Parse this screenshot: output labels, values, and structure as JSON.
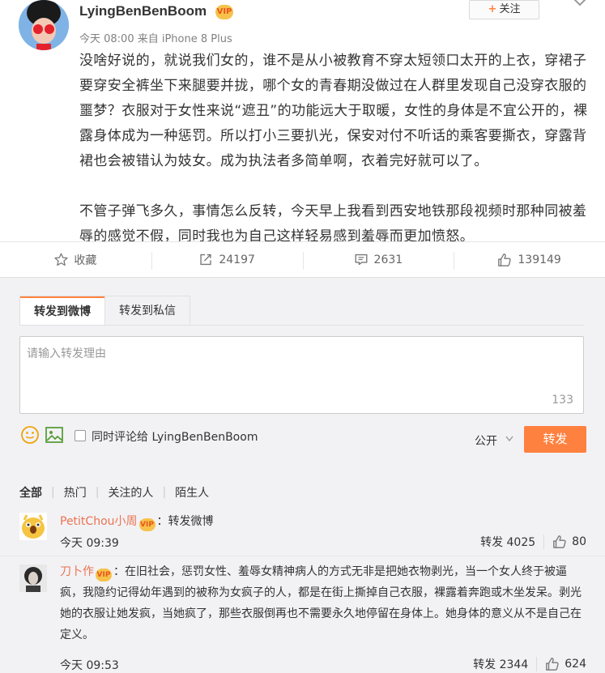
{
  "post": {
    "username": "LyingBenBenBoom",
    "vip_badge": "VIP",
    "meta": "今天 08:00 来自 iPhone 8 Plus",
    "follow_label": "关注",
    "follow_plus": "+",
    "paragraphs": [
      "没啥好说的，就说我们女的，谁不是从小被教育不穿太短领口太开的上衣，穿裙子要穿安全裤坐下来腿要并拢，哪个女的青春期没做过在人群里发现自己没穿衣服的噩梦？衣服对于女性来说“遮丑”的功能远大于取暖，女性的身体是不宜公开的，裸露身体成为一种惩罚。所以打小三要扒光，保安对付不听话的乘客要撕衣，穿露背裙也会被错认为妓女。成为执法者多简单啊，衣着完好就可以了。",
      "不管子弹飞多久，事情怎么反转，今天早上我看到西安地铁那段视频时那种同被羞辱的感觉不假，同时我也为自己这样轻易感到羞辱而更加愤怒。"
    ]
  },
  "actions": [
    {
      "name": "collect",
      "icon": "star-icon",
      "label": "收藏"
    },
    {
      "name": "repost",
      "icon": "repost-icon",
      "label": "24197"
    },
    {
      "name": "comment",
      "icon": "comment-icon",
      "label": "2631"
    },
    {
      "name": "like",
      "icon": "thumbs-up-icon",
      "label": "139149"
    }
  ],
  "repost_panel": {
    "tabs": [
      "转发到微博",
      "转发到私信"
    ],
    "placeholder": "请输入转发理由",
    "char_count": "133",
    "also_comment_label": "同时评论给 LyingBenBenBoom",
    "visibility": "公开",
    "submit_label": "转发"
  },
  "filters": [
    "全部",
    "热门",
    "关注的人",
    "陌生人"
  ],
  "comments": [
    {
      "name": "PetitChou小周",
      "text": "：转发微博",
      "time": "今天 09:39",
      "reposts": "转发 4025",
      "likes": "80"
    },
    {
      "name": "刀卜作",
      "text": "：在旧社会，惩罚女性、羞辱女精神病人的方式无非是把她衣物剥光，当一个女人终于被逼疯，我隐约记得幼年遇到的被称为女疯子的人，都是在街上撕掉自己衣服，裸露着奔跑或木坐发呆。剥光她的衣服让她发疯，当她疯了，那些衣服倒再也不需要永久地停留在身体上。她身体的意义从不是自己在定义。",
      "time": "今天 09:53",
      "reposts": "转发 2344",
      "likes": "624"
    }
  ],
  "colors": {
    "accent": "#ff8140",
    "name": "#eb7350"
  }
}
